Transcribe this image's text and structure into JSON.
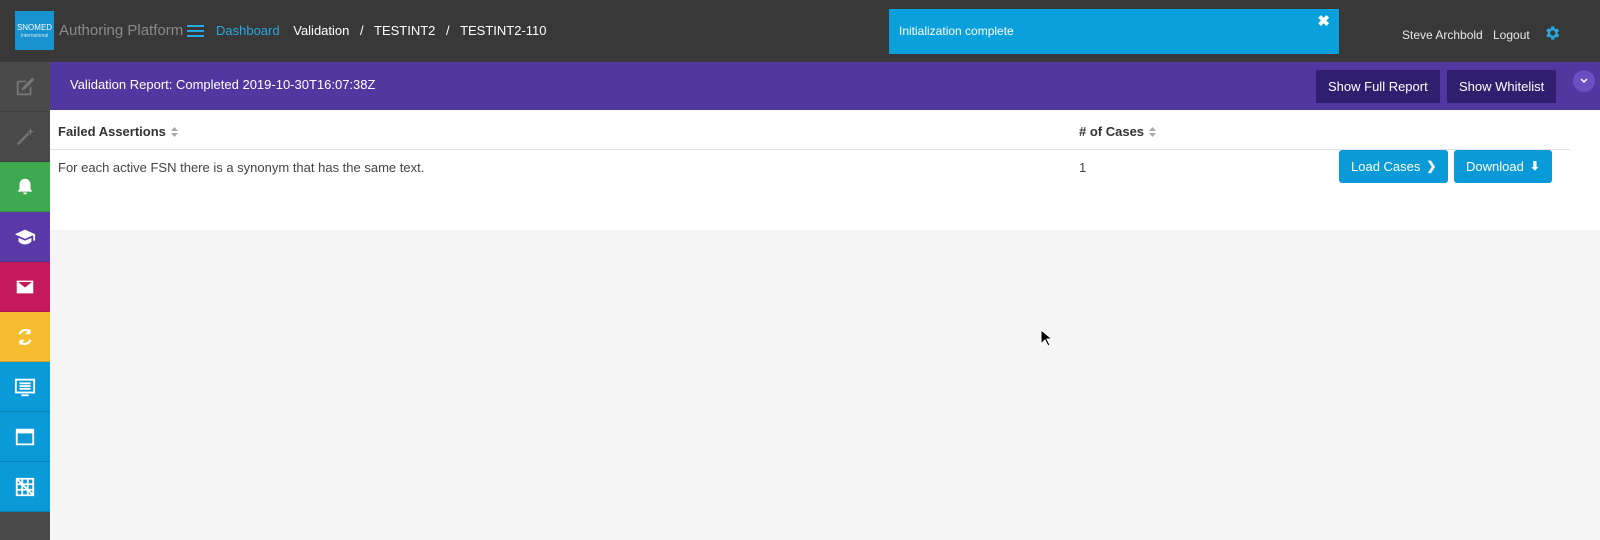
{
  "header": {
    "logo_text": "SNOMED",
    "logo_sub": "International",
    "app_title": "Authoring Platform",
    "breadcrumb": {
      "dashboard": "Dashboard",
      "items": [
        "Validation",
        "TESTINT2",
        "TESTINT2-110"
      ],
      "separator": "/"
    },
    "toast": {
      "message": "Initialization complete",
      "close": "✖"
    },
    "user_name": "Steve Archbold",
    "logout": "Logout"
  },
  "sidebar": {
    "items": [
      {
        "name": "edit",
        "icon": "edit-icon",
        "color": "#4a4a4a"
      },
      {
        "name": "wand",
        "icon": "magic-wand-icon",
        "color": "#4a4a4a"
      },
      {
        "name": "notifications",
        "icon": "bell-icon",
        "color": "#3daa50"
      },
      {
        "name": "training",
        "icon": "graduation-cap-icon",
        "color": "#5a3aa8"
      },
      {
        "name": "messages",
        "icon": "envelope-icon",
        "color": "#c51a5a"
      },
      {
        "name": "sync",
        "icon": "refresh-icon",
        "color": "#f6bd2e"
      },
      {
        "name": "list",
        "icon": "list-icon",
        "color": "#0a9ad8"
      },
      {
        "name": "browser",
        "icon": "window-icon",
        "color": "#0a9ad8"
      },
      {
        "name": "grid",
        "icon": "grid-icon",
        "color": "#0a9ad8"
      }
    ]
  },
  "report": {
    "title": "Validation Report: Completed 2019-10-30T16:07:38Z",
    "show_full_report": "Show Full Report",
    "show_whitelist": "Show Whitelist"
  },
  "table": {
    "columns": [
      "Failed Assertions",
      "# of Cases"
    ],
    "rows": [
      {
        "assertion": "For each active FSN there is a synonym that has the same text.",
        "cases": "1",
        "load_label": "Load Cases",
        "download_label": "Download"
      }
    ]
  },
  "colors": {
    "topbar": "#383838",
    "accent": "#0a9ad8",
    "report_bar": "#5038a0"
  }
}
